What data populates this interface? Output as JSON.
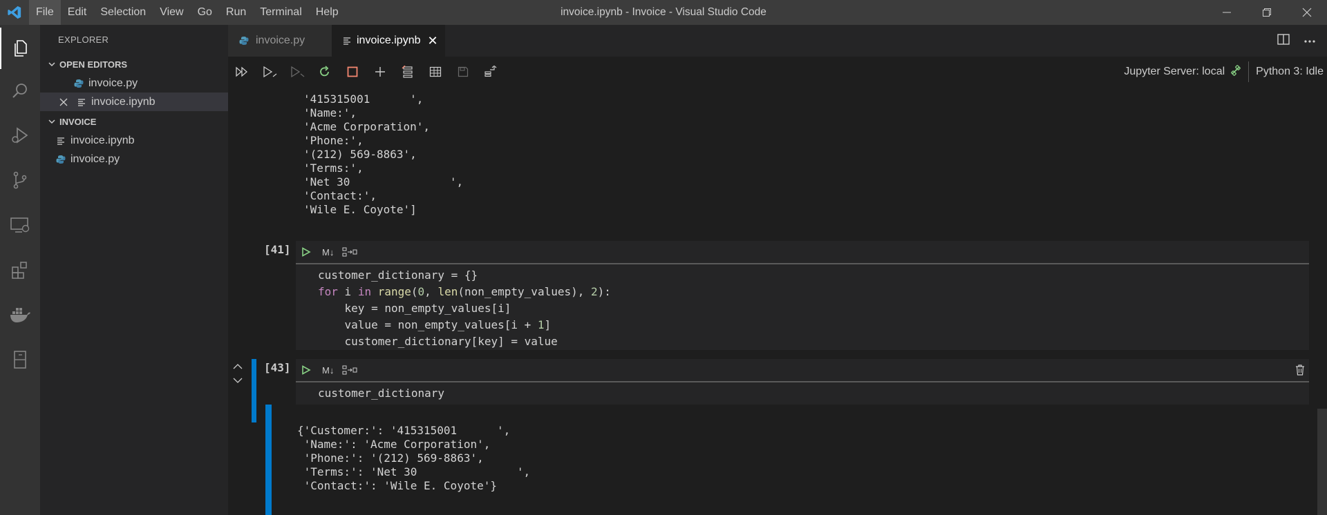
{
  "window": {
    "title": "invoice.ipynb - Invoice - Visual Studio Code",
    "menu": [
      "File",
      "Edit",
      "Selection",
      "View",
      "Go",
      "Run",
      "Terminal",
      "Help"
    ]
  },
  "activity_bar": [
    "files-icon",
    "search-icon",
    "run-debug-icon",
    "source-control-icon",
    "remote-explorer-icon",
    "extensions-icon",
    "docker-icon",
    "notebook-icon"
  ],
  "sidebar": {
    "header": "EXPLORER",
    "open_editors": {
      "label": "OPEN EDITORS",
      "items": [
        "invoice.py",
        "invoice.ipynb"
      ]
    },
    "folder": {
      "label": "INVOICE",
      "items": [
        "invoice.ipynb",
        "invoice.py"
      ]
    }
  },
  "tabs": [
    {
      "label": "invoice.py",
      "active": false
    },
    {
      "label": "invoice.ipynb",
      "active": true
    }
  ],
  "toolbar": {
    "jupyter_server": "Jupyter Server: local",
    "kernel": "Python 3: Idle"
  },
  "output_top": [
    "'415315001      ',",
    "'Name:',",
    "'Acme Corporation',",
    "'Phone:',",
    "'(212) 569-8863',",
    "'Terms:',",
    "'Net 30               ',",
    "'Contact:',",
    "'Wile E. Coyote']"
  ],
  "cells": [
    {
      "exec_count": "[41]",
      "md_label": "M↓"
    },
    {
      "exec_count": "[43]",
      "md_label": "M↓",
      "code": "customer_dictionary"
    }
  ],
  "output_bottom": [
    "{'Customer:': '415315001      ',",
    " 'Name:': 'Acme Corporation',",
    " 'Phone:': '(212) 569-8863',",
    " 'Terms:': 'Net 30               ',",
    " 'Contact:': 'Wile E. Coyote'}"
  ],
  "colors": {
    "accent": "#007acc",
    "run_green": "#89d185",
    "stop_red": "#f48771"
  }
}
